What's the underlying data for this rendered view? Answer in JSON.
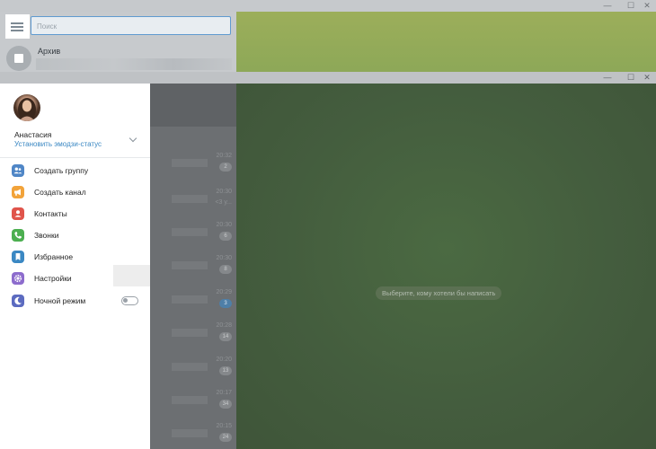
{
  "back_window": {
    "search": {
      "placeholder": "Поиск",
      "value": ""
    },
    "archive_label": "Архив"
  },
  "window_controls": {
    "minimize": "—",
    "maximize": "☐",
    "close": "✕"
  },
  "profile": {
    "name": "Анастасия",
    "emoji_status": "Установить эмодзи-статус"
  },
  "menu": {
    "items": [
      {
        "label": "Создать группу",
        "icon": "group-icon",
        "color": "#4f86c6"
      },
      {
        "label": "Создать канал",
        "icon": "megaphone-icon",
        "color": "#f2a33a"
      },
      {
        "label": "Контакты",
        "icon": "contact-icon",
        "color": "#e0544b"
      },
      {
        "label": "Звонки",
        "icon": "phone-icon",
        "color": "#4caf50"
      },
      {
        "label": "Избранное",
        "icon": "bookmark-icon",
        "color": "#3b88c3"
      },
      {
        "label": "Настройки",
        "icon": "gear-icon",
        "color": "#8d6ccd"
      },
      {
        "label": "Ночной режим",
        "icon": "moon-icon",
        "color": "#5c6bc0"
      }
    ],
    "night_mode_on": false
  },
  "chat_list": {
    "rows": [
      {
        "time": "20:32",
        "badge": "2"
      },
      {
        "time": "20:30",
        "sub": "<3 у..."
      },
      {
        "time": "20:30",
        "badge": "6"
      },
      {
        "time": "20:30",
        "badge": "8"
      },
      {
        "time": "20:29",
        "badge": "3"
      },
      {
        "time": "20:28",
        "badge": "14"
      },
      {
        "time": "20:20",
        "badge": "13"
      },
      {
        "time": "20:17",
        "badge": "34"
      },
      {
        "time": "20:15",
        "badge": "24"
      }
    ]
  },
  "empty_chat_message": "Выберите, кому хотели бы написать"
}
